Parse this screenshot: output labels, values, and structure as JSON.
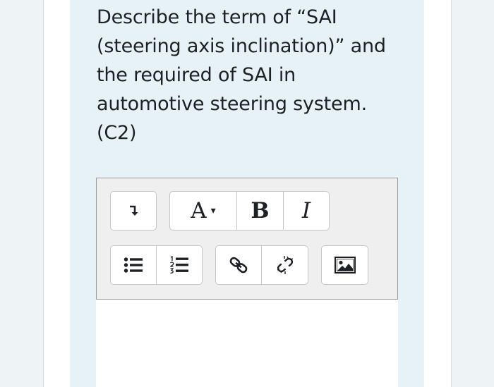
{
  "question": {
    "lines": [
      "Describe the term of “SAI",
      "(steering axis inclination)” and",
      "the required of SAI in",
      "automotive steering system.",
      "(C2)"
    ]
  },
  "toolbar": {
    "font_button_label": "A",
    "font_caret": "▾",
    "bold_label": "B",
    "italic_label": "I",
    "icons": [
      "expand-toolbar-icon",
      "bulleted-list-icon",
      "numbered-list-icon",
      "link-icon",
      "unlink-icon",
      "image-icon"
    ]
  },
  "colors": {
    "card_background": "#e7f2f6",
    "toolbar_background": "#efefef",
    "text": "#1d2125"
  }
}
